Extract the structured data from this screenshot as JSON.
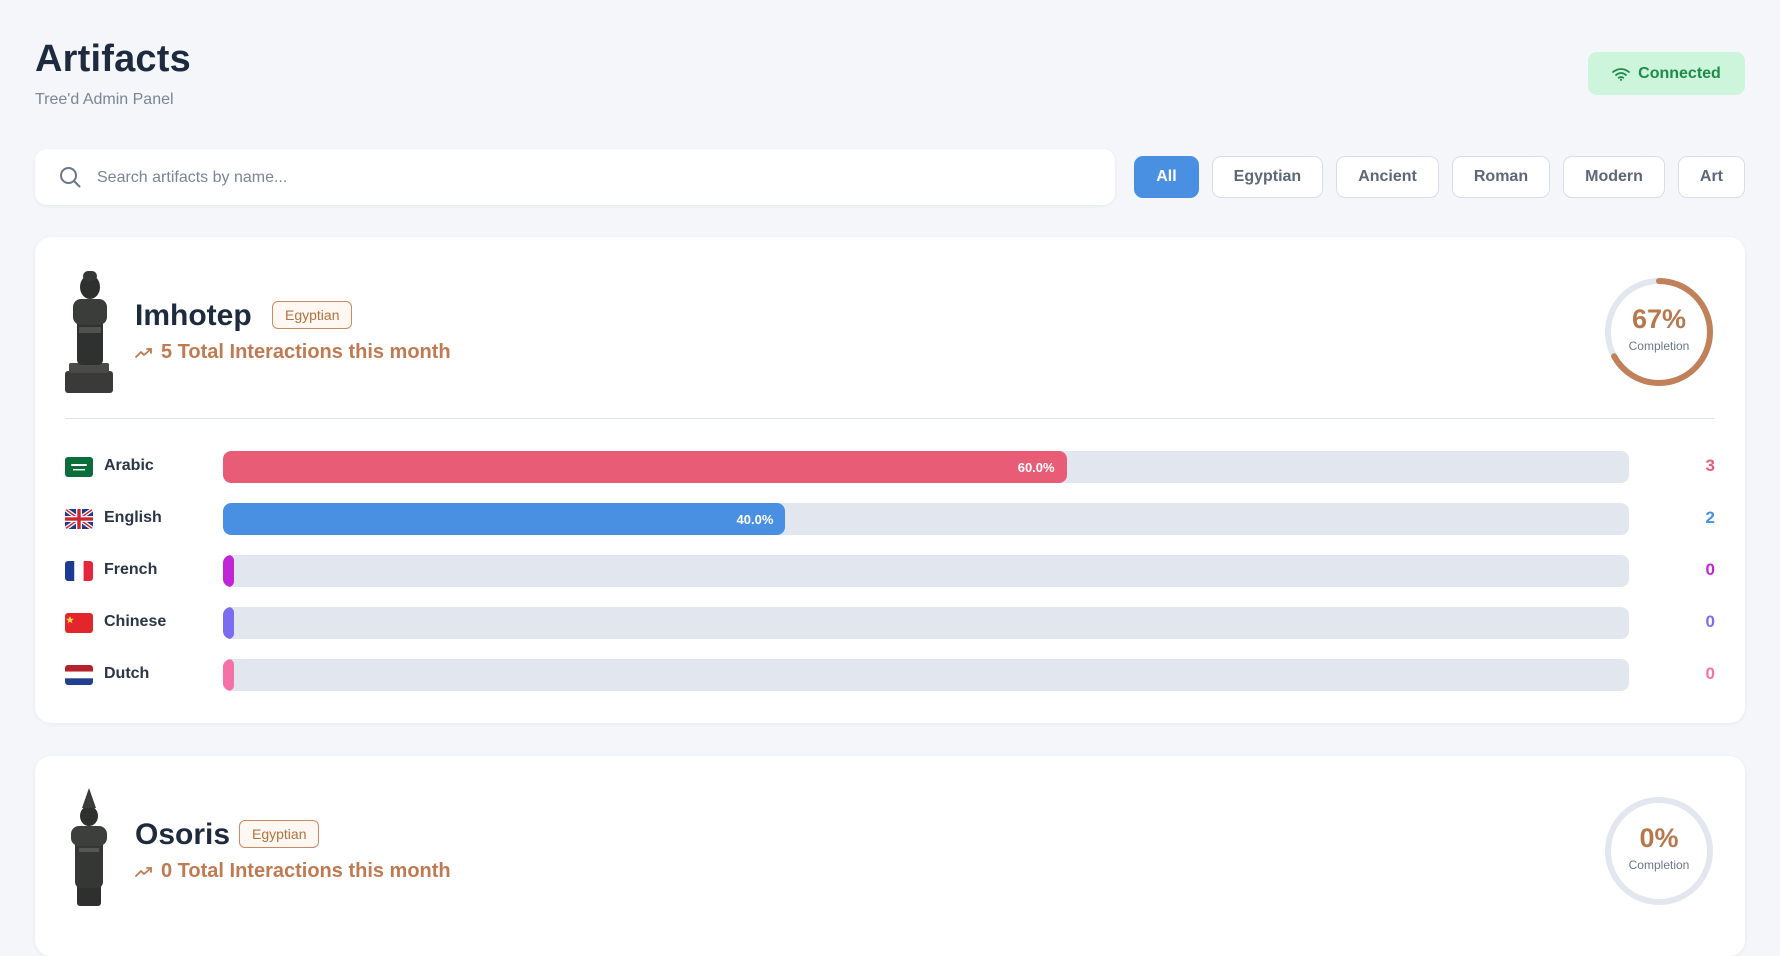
{
  "header": {
    "title": "Artifacts",
    "subtitle": "Tree'd Admin Panel",
    "status": "Connected",
    "status_icon": "wifi-icon"
  },
  "search": {
    "placeholder": "Search artifacts by name...",
    "value": "",
    "icon": "search-icon"
  },
  "filters": [
    {
      "label": "All",
      "active": true
    },
    {
      "label": "Egyptian",
      "active": false
    },
    {
      "label": "Ancient",
      "active": false
    },
    {
      "label": "Roman",
      "active": false
    },
    {
      "label": "Modern",
      "active": false
    },
    {
      "label": "Art",
      "active": false
    }
  ],
  "artifacts": [
    {
      "name": "Imhotep",
      "category": "Egyptian",
      "interactions": "5 Total Interactions this month",
      "completion": "67%",
      "completion_value": 0.67,
      "completion_label": "Completion",
      "languages": [
        {
          "name": "Arabic",
          "share": 0.6,
          "pct_label": "60.0%",
          "count": "3",
          "color": "#e85d75",
          "flag": "saudi-arabia-flag"
        },
        {
          "name": "English",
          "share": 0.4,
          "pct_label": "40.0%",
          "count": "2",
          "color": "#4a90e2",
          "flag": "uk-flag"
        },
        {
          "name": "French",
          "share": 0,
          "pct_label": "",
          "count": "0",
          "color": "#c026d3",
          "flag": "france-flag"
        },
        {
          "name": "Chinese",
          "share": 0,
          "pct_label": "",
          "count": "0",
          "color": "#7c6cf0",
          "flag": "china-flag"
        },
        {
          "name": "Dutch",
          "share": 0,
          "pct_label": "",
          "count": "0",
          "color": "#f472a6",
          "flag": "netherlands-flag"
        }
      ]
    },
    {
      "name": "Osoris",
      "category": "Egyptian",
      "interactions": "0 Total Interactions this month",
      "completion": "0%",
      "completion_value": 0,
      "completion_label": "Completion"
    }
  ],
  "colors": {
    "accent": "#4a90e2",
    "connected_bg": "#cdf5dc",
    "connected_text": "#1f8a4c",
    "ring_progress": "#c0805a",
    "ring_track": "#e2e7ef"
  }
}
